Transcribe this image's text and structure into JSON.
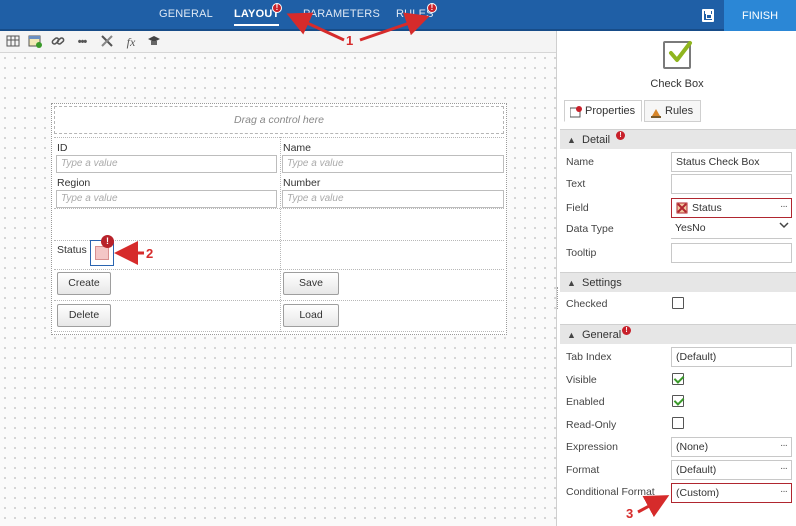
{
  "topbar": {
    "tabs": [
      {
        "label": "GENERAL",
        "active": false,
        "error": false
      },
      {
        "label": "LAYOUT",
        "active": true,
        "error": true
      },
      {
        "label": "PARAMETERS",
        "active": false,
        "error": false
      },
      {
        "label": "RULES",
        "active": false,
        "error": true
      }
    ],
    "finish_label": "FINISH",
    "save_icon": "save-icon"
  },
  "toolbar": {
    "icons": [
      "table-icon",
      "add-form-icon",
      "link-icon",
      "more-icon",
      "tools-icon",
      "function-icon",
      "graduate-icon"
    ],
    "function_glyph": "fx"
  },
  "form": {
    "drop_hint": "Drag a control here",
    "fields": [
      {
        "label": "ID",
        "placeholder": "Type a value"
      },
      {
        "label": "Name",
        "placeholder": "Type a value"
      },
      {
        "label": "Region",
        "placeholder": "Type a value"
      },
      {
        "label": "Number",
        "placeholder": "Type a value"
      }
    ],
    "status_label": "Status",
    "status_error_badge": "!",
    "buttons": {
      "create": "Create",
      "save": "Save",
      "delete": "Delete",
      "load": "Load"
    }
  },
  "panel": {
    "control_name": "Check Box",
    "tabs": [
      {
        "label": "Properties",
        "active": true
      },
      {
        "label": "Rules",
        "active": false
      }
    ],
    "sections": {
      "detail": "Detail",
      "settings": "Settings",
      "general": "General"
    },
    "detail": [
      {
        "label": "Name",
        "value": "Status Check Box"
      },
      {
        "label": "Text",
        "value": ""
      },
      {
        "label": "Field",
        "value": "Status"
      },
      {
        "label": "Data Type",
        "value": "YesNo"
      },
      {
        "label": "Tooltip",
        "value": ""
      }
    ],
    "settings": [
      {
        "label": "Checked",
        "checked": false
      }
    ],
    "general": [
      {
        "label": "Tab Index",
        "value": "(Default)"
      },
      {
        "label": "Visible",
        "checked": true
      },
      {
        "label": "Enabled",
        "checked": true
      },
      {
        "label": "Read-Only",
        "checked": false
      },
      {
        "label": "Expression",
        "value": "(None)"
      },
      {
        "label": "Format",
        "value": "(Default)"
      },
      {
        "label": "Conditional Format",
        "value": "(Custom)"
      }
    ]
  },
  "annotations": {
    "one": "1",
    "two": "2",
    "three": "3"
  },
  "colors": {
    "topbar": "#1f5fa6",
    "finish": "#2b87d6",
    "error": "#c8202a",
    "annotation": "#d62b2b"
  }
}
